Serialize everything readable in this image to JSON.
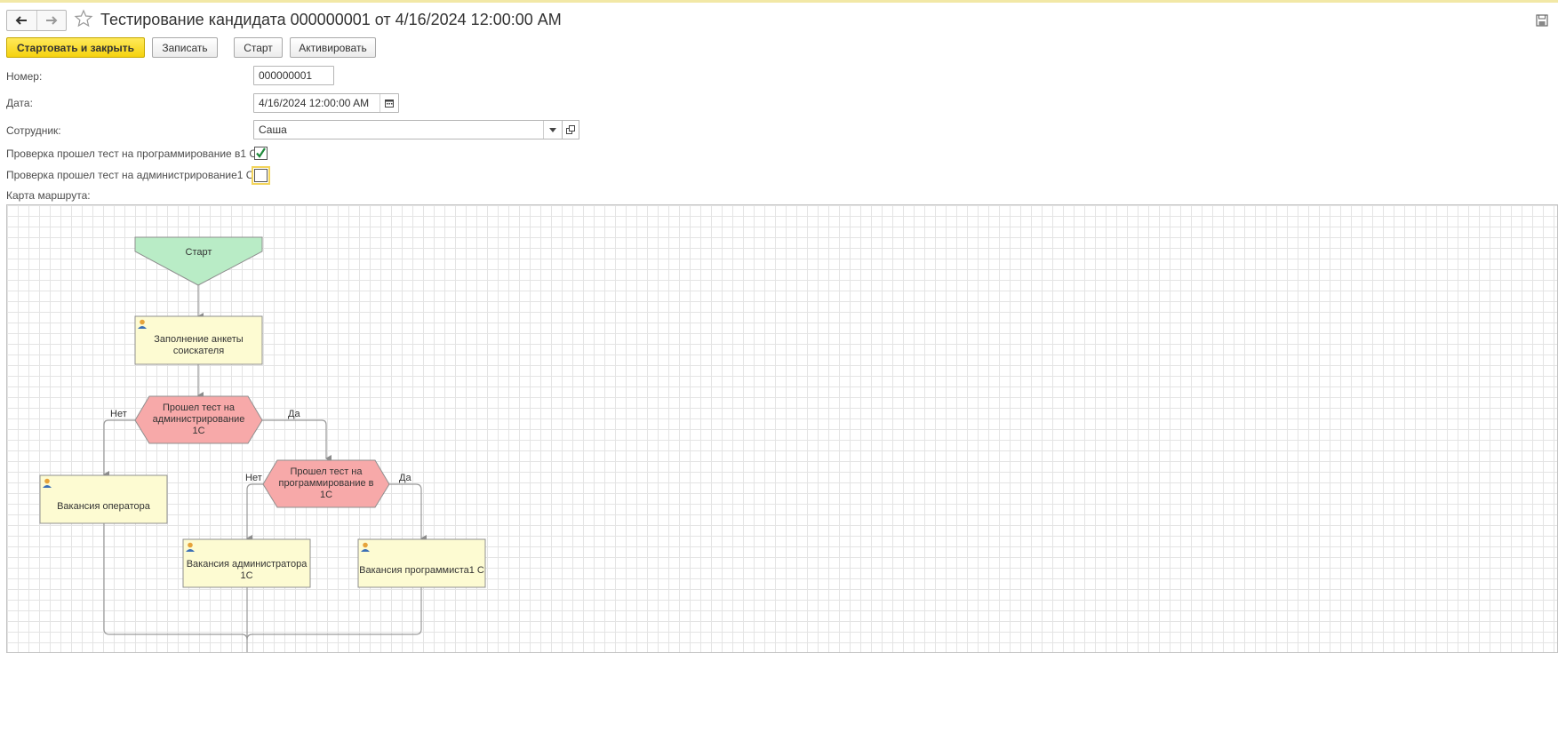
{
  "header": {
    "title": "Тестирование кандидата 000000001 от 4/16/2024 12:00:00 AM"
  },
  "toolbar": {
    "start_close": "Стартовать и закрыть",
    "save": "Записать",
    "start": "Старт",
    "activate": "Активировать"
  },
  "form": {
    "number_label": "Номер:",
    "number_value": "000000001",
    "date_label": "Дата:",
    "date_value": "4/16/2024 12:00:00 AM",
    "employee_label": "Сотрудник:",
    "employee_value": "Саша",
    "check_prog_label": "Проверка прошел тест на программирование в1 С:",
    "check_prog_checked": true,
    "check_admin_label": "Проверка прошел тест на администрирование1 С:",
    "check_admin_checked": false,
    "route_map_label": "Карта маршрута:"
  },
  "route_map": {
    "start": "Старт",
    "task_fill_form": "Заполнение анкеты соискателя",
    "cond_admin": "Прошел тест на администрирование 1С",
    "cond_prog": "Прошел тест на программирование в 1С",
    "task_operator": "Вакансия оператора",
    "task_admin": "Вакансия администратора 1С",
    "task_programmer": "Вакансия программиста1 С",
    "label_no_1": "Нет",
    "label_yes_1": "Да",
    "label_no_2": "Нет",
    "label_yes_2": "Да"
  },
  "colors": {
    "accent_button": "#f5d20f",
    "start_node": "#b9ecc6",
    "task_node": "#fdfbd2",
    "condition_node": "#f7a9a9"
  }
}
